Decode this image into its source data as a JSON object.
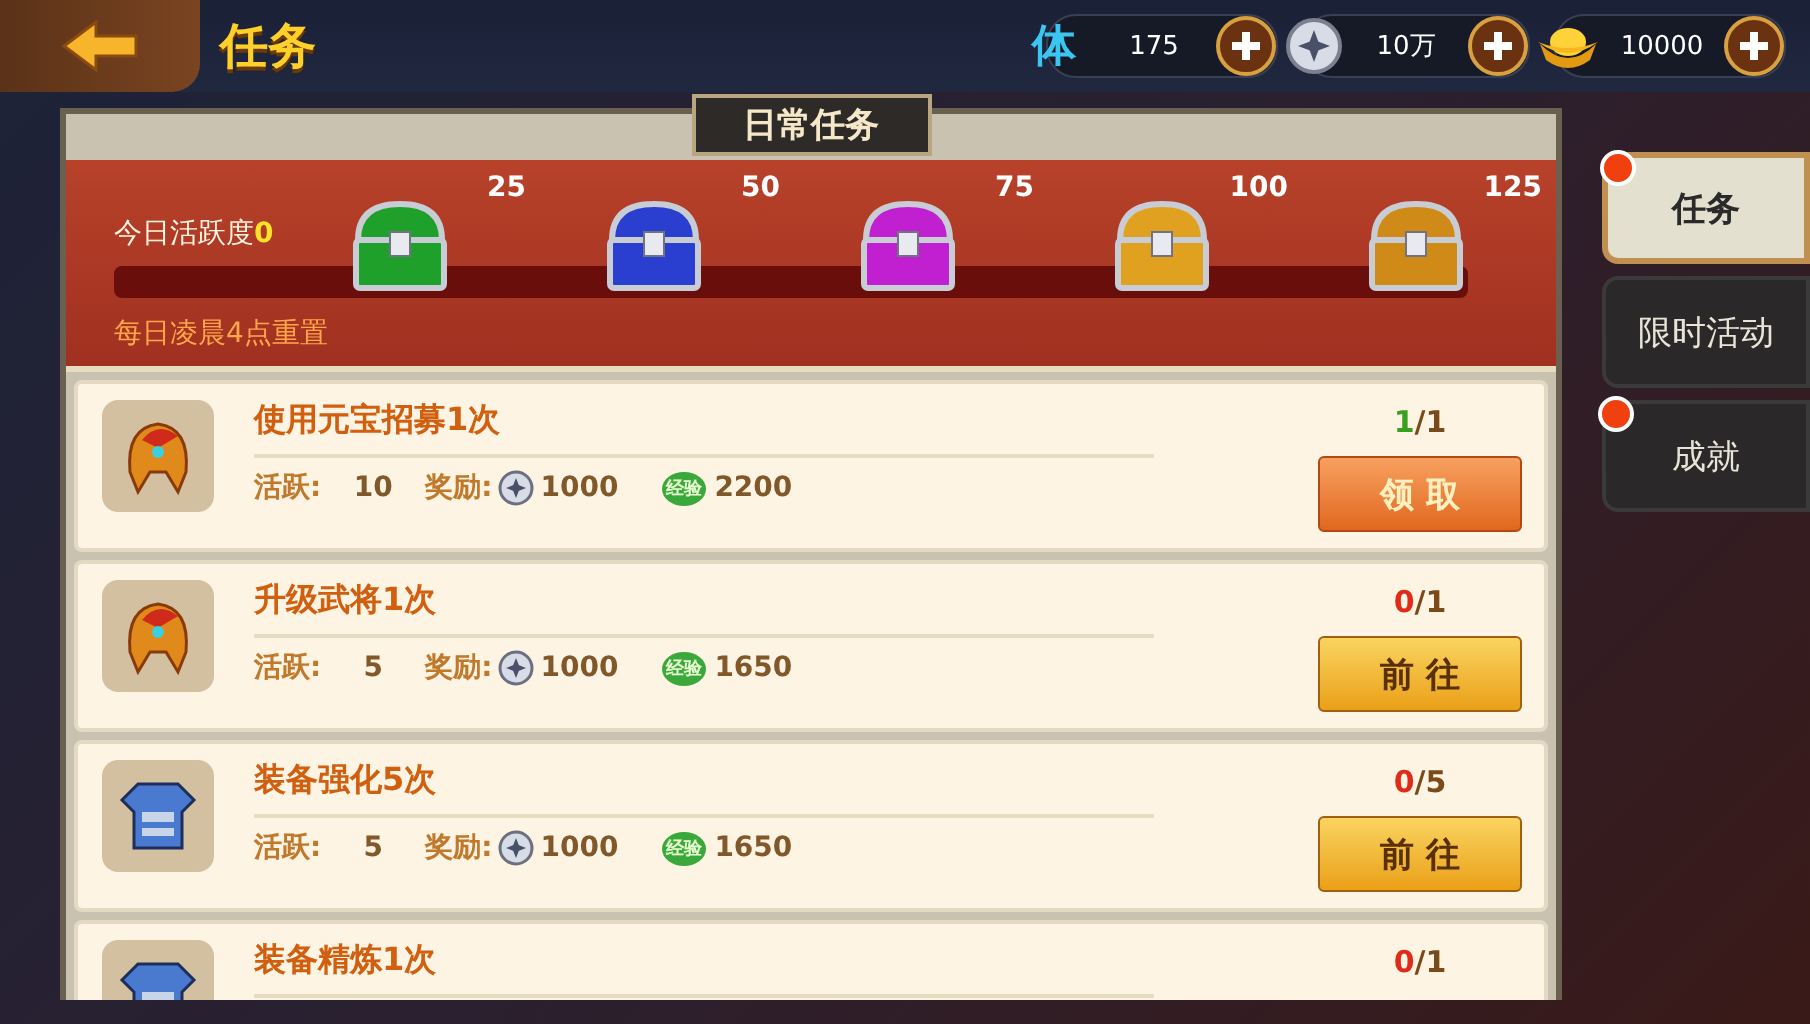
{
  "header": {
    "title": "任务"
  },
  "resources": [
    {
      "kind": "stamina",
      "label": "体",
      "value": "175"
    },
    {
      "kind": "coin",
      "value": "10万"
    },
    {
      "kind": "gold",
      "value": "10000"
    }
  ],
  "panel": {
    "title": "日常任务"
  },
  "activity": {
    "label": "今日活跃度",
    "value": "0",
    "reset_note": "每日凌晨4点重置",
    "level": 0,
    "chests": [
      {
        "points": "25",
        "color": "#1fa02a"
      },
      {
        "points": "50",
        "color": "#2a3fd0"
      },
      {
        "points": "75",
        "color": "#c020d0"
      },
      {
        "points": "100",
        "color": "#e0a020"
      },
      {
        "points": "125",
        "color": "#d08a18"
      }
    ]
  },
  "tasks": [
    {
      "kind": "helmet",
      "name": "使用元宝招募1次",
      "activity_label": "活跃:",
      "activity": "10",
      "reward_label": "奖励:",
      "coins": "1000",
      "exp_badge": "经验",
      "exp": "2200",
      "done": "1",
      "total": "/1",
      "complete": true,
      "button": {
        "label": "领 取",
        "kind": "claim"
      }
    },
    {
      "kind": "helmet",
      "name": "升级武将1次",
      "activity_label": "活跃:",
      "activity": "5",
      "reward_label": "奖励:",
      "coins": "1000",
      "exp_badge": "经验",
      "exp": "1650",
      "done": "0",
      "total": "/1",
      "complete": false,
      "button": {
        "label": "前 往",
        "kind": "go"
      }
    },
    {
      "kind": "armor",
      "name": "装备强化5次",
      "activity_label": "活跃:",
      "activity": "5",
      "reward_label": "奖励:",
      "coins": "1000",
      "exp_badge": "经验",
      "exp": "1650",
      "done": "0",
      "total": "/5",
      "complete": false,
      "button": {
        "label": "前 往",
        "kind": "go"
      }
    },
    {
      "kind": "armor",
      "name": "装备精炼1次",
      "done": "0",
      "total": "/1",
      "complete": false
    }
  ],
  "side_tabs": [
    {
      "label": "任务",
      "selected": true,
      "badge": true
    },
    {
      "label": "限时活动",
      "selected": false,
      "badge": false
    },
    {
      "label": "成就",
      "selected": false,
      "badge": true
    }
  ]
}
